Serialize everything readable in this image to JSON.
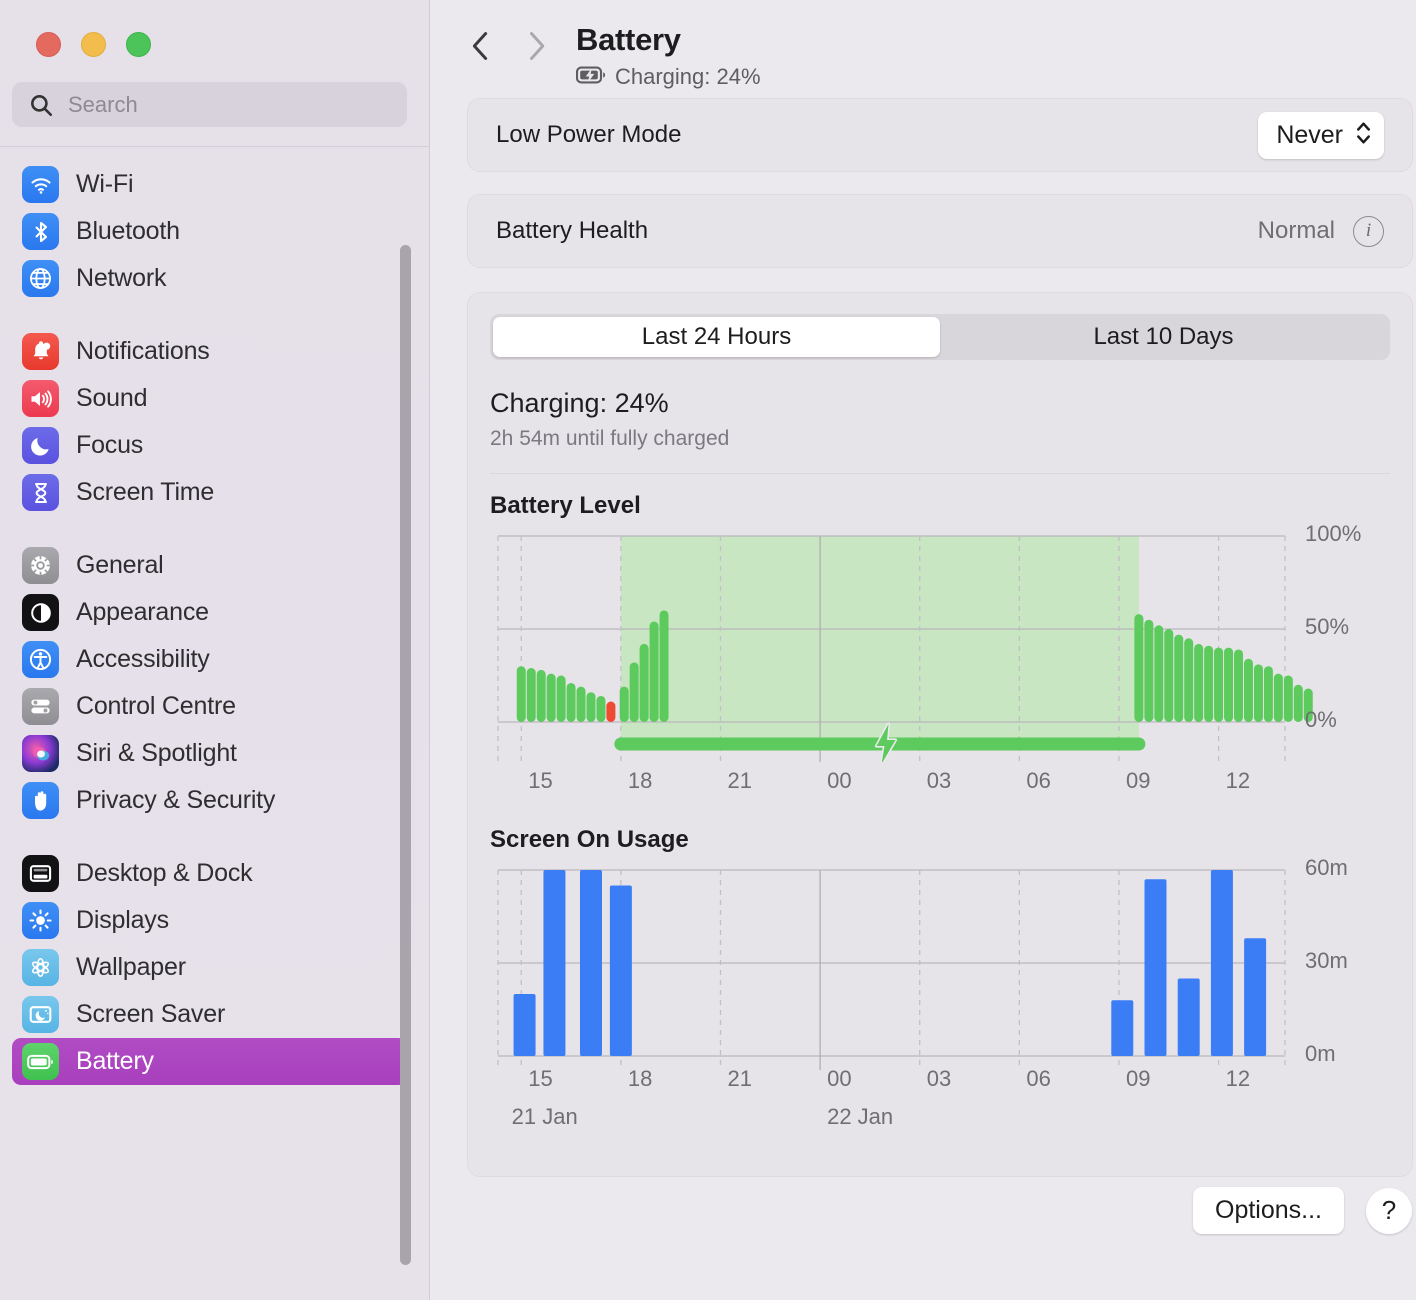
{
  "window": {
    "traffic_lights": [
      "close",
      "minimize",
      "zoom"
    ]
  },
  "sidebar": {
    "search": {
      "placeholder": "Search",
      "value": ""
    },
    "groups": [
      {
        "items": [
          {
            "label": "Wi-Fi",
            "icon": "wifi-icon"
          },
          {
            "label": "Bluetooth",
            "icon": "bluetooth-icon"
          },
          {
            "label": "Network",
            "icon": "network-icon"
          }
        ]
      },
      {
        "items": [
          {
            "label": "Notifications",
            "icon": "bell-icon"
          },
          {
            "label": "Sound",
            "icon": "speaker-icon"
          },
          {
            "label": "Focus",
            "icon": "moon-icon"
          },
          {
            "label": "Screen Time",
            "icon": "hourglass-icon"
          }
        ]
      },
      {
        "items": [
          {
            "label": "General",
            "icon": "gear-icon"
          },
          {
            "label": "Appearance",
            "icon": "appearance-icon"
          },
          {
            "label": "Accessibility",
            "icon": "accessibility-icon"
          },
          {
            "label": "Control Centre",
            "icon": "control-centre-icon"
          },
          {
            "label": "Siri & Spotlight",
            "icon": "siri-icon"
          },
          {
            "label": "Privacy & Security",
            "icon": "hand-icon"
          }
        ]
      },
      {
        "items": [
          {
            "label": "Desktop & Dock",
            "icon": "desktop-dock-icon"
          },
          {
            "label": "Displays",
            "icon": "brightness-icon"
          },
          {
            "label": "Wallpaper",
            "icon": "wallpaper-icon"
          },
          {
            "label": "Screen Saver",
            "icon": "screen-saver-icon"
          },
          {
            "label": "Battery",
            "icon": "battery-icon",
            "selected": true
          }
        ]
      }
    ]
  },
  "header": {
    "back_icon": "chevron-left-icon",
    "forward_icon": "chevron-right-icon",
    "title": "Battery",
    "status_icon": "battery-charging-icon",
    "status": "Charging: 24%"
  },
  "low_power": {
    "label": "Low Power Mode",
    "value": "Never",
    "chevron_icon": "chevron-up-down-icon"
  },
  "battery_health": {
    "label": "Battery Health",
    "value": "Normal",
    "info_icon": "info-icon"
  },
  "usage": {
    "tabs": [
      {
        "label": "Last 24 Hours",
        "active": true
      },
      {
        "label": "Last 10 Days",
        "active": false
      }
    ],
    "charging_title": "Charging: 24%",
    "charging_subtitle": "2h 54m until fully charged"
  },
  "footer": {
    "options_label": "Options...",
    "help_label": "?"
  },
  "chart_data": [
    {
      "type": "bar",
      "title": "Battery Level",
      "xlabel": "",
      "ylabel": "",
      "ylim": [
        0,
        100
      ],
      "ytick_labels": [
        "100%",
        "50%",
        "0%"
      ],
      "ytick_values": [
        100,
        50,
        0
      ],
      "xtick_labels": [
        "15",
        "18",
        "21",
        "00",
        "03",
        "06",
        "09",
        "12"
      ],
      "xtick_values": [
        15,
        18,
        21,
        24,
        27,
        30,
        33,
        36
      ],
      "x_range": [
        14.3,
        38.0
      ],
      "grid": true,
      "bar_color": "#5cca5c",
      "low_bar_color": "#ef4a32",
      "charging_region_color": "#c8e6c1",
      "series": [
        {
          "name": "Battery Level",
          "points": [
            {
              "x": 15.0,
              "y": 30,
              "low": false
            },
            {
              "x": 15.3,
              "y": 29,
              "low": false
            },
            {
              "x": 15.6,
              "y": 28,
              "low": false
            },
            {
              "x": 15.9,
              "y": 26,
              "low": false
            },
            {
              "x": 16.2,
              "y": 25,
              "low": false
            },
            {
              "x": 16.5,
              "y": 21,
              "low": false
            },
            {
              "x": 16.8,
              "y": 19,
              "low": false
            },
            {
              "x": 17.1,
              "y": 16,
              "low": false
            },
            {
              "x": 17.4,
              "y": 14,
              "low": false
            },
            {
              "x": 17.7,
              "y": 11,
              "low": true
            },
            {
              "x": 18.1,
              "y": 19,
              "low": false
            },
            {
              "x": 18.4,
              "y": 32,
              "low": false
            },
            {
              "x": 18.7,
              "y": 42,
              "low": false
            },
            {
              "x": 19.0,
              "y": 54,
              "low": false
            },
            {
              "x": 19.3,
              "y": 60,
              "low": false
            }
          ]
        },
        {
          "name": "Battery Level Afternoon",
          "points": [
            {
              "x": 33.6,
              "y": 58,
              "low": false
            },
            {
              "x": 33.9,
              "y": 55,
              "low": false
            },
            {
              "x": 34.2,
              "y": 52,
              "low": false
            },
            {
              "x": 34.5,
              "y": 50,
              "low": false
            },
            {
              "x": 34.8,
              "y": 47,
              "low": false
            },
            {
              "x": 35.1,
              "y": 45,
              "low": false
            },
            {
              "x": 35.4,
              "y": 42,
              "low": false
            },
            {
              "x": 35.7,
              "y": 41,
              "low": false
            },
            {
              "x": 36.0,
              "y": 40,
              "low": false
            },
            {
              "x": 36.3,
              "y": 40,
              "low": false
            },
            {
              "x": 36.6,
              "y": 39,
              "low": false
            },
            {
              "x": 36.9,
              "y": 34,
              "low": false
            },
            {
              "x": 37.2,
              "y": 31,
              "low": false
            },
            {
              "x": 37.5,
              "y": 30,
              "low": false
            },
            {
              "x": 37.8,
              "y": 26,
              "low": false
            },
            {
              "x": 38.1,
              "y": 25,
              "low": false
            },
            {
              "x": 38.4,
              "y": 20,
              "low": false
            },
            {
              "x": 38.7,
              "y": 18,
              "low": false
            }
          ]
        }
      ],
      "charging_region": {
        "start": 18.0,
        "end": 33.6
      },
      "charging_bar": {
        "start": 18.0,
        "end": 33.6,
        "icon": "bolt-icon",
        "icon_x": 26.0
      }
    },
    {
      "type": "bar",
      "title": "Screen On Usage",
      "xlabel": "",
      "ylabel": "",
      "ylim": [
        0,
        60
      ],
      "ytick_labels": [
        "60m",
        "30m",
        "0m"
      ],
      "ytick_values": [
        60,
        30,
        0
      ],
      "xtick_labels": [
        "15",
        "18",
        "21",
        "00",
        "03",
        "06",
        "09",
        "12"
      ],
      "xtick_values": [
        15,
        18,
        21,
        24,
        27,
        30,
        33,
        36
      ],
      "day_labels": [
        {
          "label": "21 Jan",
          "x": 14.5
        },
        {
          "label": "22 Jan",
          "x": 24.0
        }
      ],
      "x_range": [
        14.3,
        38.0
      ],
      "grid": true,
      "bar_color": "#3b7df5",
      "categories": [
        15,
        16,
        17,
        18,
        19,
        33,
        34,
        35,
        36,
        37
      ],
      "values": [
        20,
        60,
        60,
        55,
        0,
        18,
        57,
        25,
        60,
        38
      ],
      "points": [
        {
          "x": 15.1,
          "y": 20
        },
        {
          "x": 16.0,
          "y": 60
        },
        {
          "x": 17.1,
          "y": 60
        },
        {
          "x": 18.0,
          "y": 55
        },
        {
          "x": 33.1,
          "y": 18
        },
        {
          "x": 34.1,
          "y": 57
        },
        {
          "x": 35.1,
          "y": 25
        },
        {
          "x": 36.1,
          "y": 60
        },
        {
          "x": 37.1,
          "y": 38
        }
      ]
    }
  ]
}
